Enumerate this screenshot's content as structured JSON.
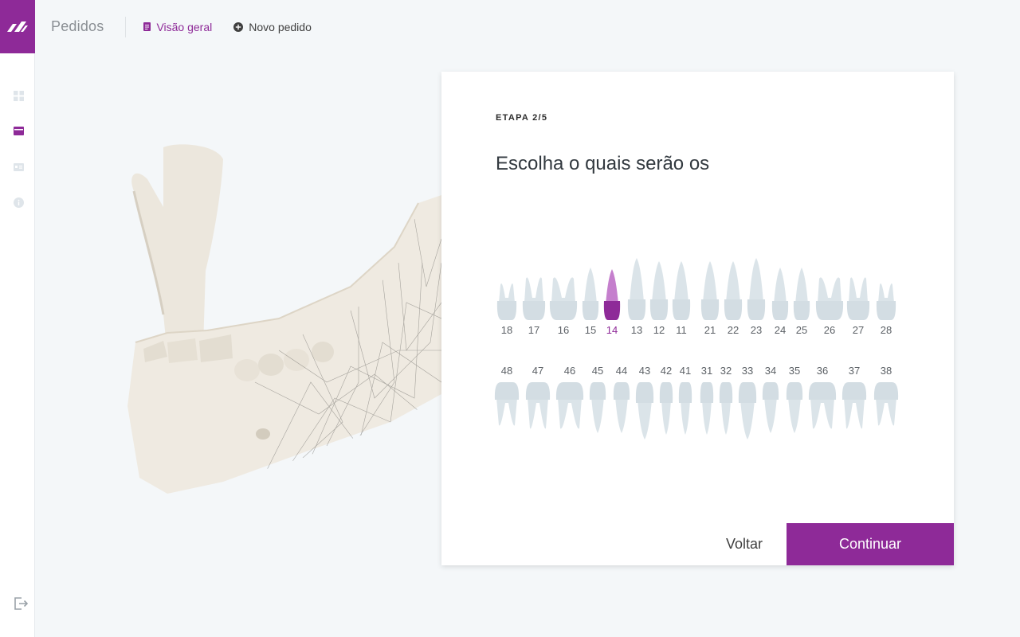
{
  "brand": {
    "accent": "#8e2a98",
    "logo_icon": "brand-logo-icon"
  },
  "header": {
    "section_title": "Pedidos",
    "tabs": [
      {
        "label": "Visão geral",
        "icon": "document-icon",
        "active": true
      },
      {
        "label": "Novo pedido",
        "icon": "plus-circle-icon",
        "active": false
      }
    ]
  },
  "sidebar": {
    "items": [
      {
        "icon": "grid-icon",
        "active": false
      },
      {
        "icon": "box-icon",
        "active": true
      },
      {
        "icon": "id-card-icon",
        "active": false
      },
      {
        "icon": "info-icon",
        "active": false
      }
    ],
    "bottom": {
      "icon": "logout-icon"
    }
  },
  "wizard": {
    "step_label": "ETAPA 2/5",
    "heading": "Escolha o quais serão os",
    "upper_teeth": [
      "18",
      "17",
      "16",
      "15",
      "14",
      "13",
      "12",
      "11",
      "21",
      "22",
      "23",
      "24",
      "25",
      "26",
      "27",
      "28"
    ],
    "lower_teeth": [
      "48",
      "47",
      "46",
      "45",
      "44",
      "43",
      "42",
      "41",
      "31",
      "32",
      "33",
      "34",
      "35",
      "36",
      "37",
      "38"
    ],
    "selected": [
      "14"
    ],
    "colors": {
      "tooth": "#d3dde3",
      "tooth_root": "#dbe4e9",
      "selected_crown": "#8e2a98",
      "selected_root": "#c57fcd",
      "label": "#5c6166"
    },
    "back_label": "Voltar",
    "continue_label": "Continuar"
  }
}
